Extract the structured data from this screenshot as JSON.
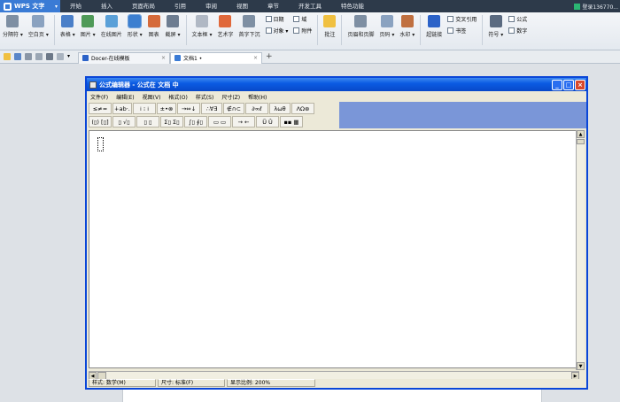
{
  "app": {
    "name": "WPS 文字",
    "login_text": "登录136770..."
  },
  "menu_tabs": [
    "开始",
    "插入",
    "页面布局",
    "引用",
    "审阅",
    "视图",
    "章节",
    "开发工具",
    "特色功能"
  ],
  "ribbon": {
    "buttons": [
      {
        "label": "分隔符 ▾"
      },
      {
        "label": "空白页 ▾"
      },
      {
        "label": "表格 ▾"
      },
      {
        "label": "图片 ▾"
      },
      {
        "label": "在线图片"
      },
      {
        "label": "形状 ▾"
      },
      {
        "label": "图表"
      },
      {
        "label": "截屏 ▾"
      },
      {
        "label": "文本框 ▾"
      },
      {
        "label": "艺术字"
      },
      {
        "label": "首字下沉"
      }
    ],
    "small_items": [
      [
        "日期",
        "对象 ▾"
      ],
      [
        "域",
        "附件"
      ]
    ],
    "buttons2": [
      {
        "label": "批注"
      },
      {
        "label": "页眉和页脚"
      },
      {
        "label": "页码 ▾"
      },
      {
        "label": "水印 ▾"
      },
      {
        "label": "超链接"
      }
    ],
    "small_items2": [
      "交叉引用",
      "书签"
    ],
    "buttons3": [
      {
        "label": "符号 ▾"
      }
    ],
    "small_items3": [
      "公式",
      "数字"
    ]
  },
  "doc_tabs": [
    {
      "label": "Docer-在线模板",
      "close": "×"
    },
    {
      "label": "文档1 •",
      "close": "×"
    }
  ],
  "equation_editor": {
    "title": "公式编辑器 - 公式在 文档 中",
    "window_buttons": {
      "minimize": "_",
      "maximize": "□",
      "close": "×"
    },
    "menu": [
      "文件(F)",
      "编辑(E)",
      "视图(V)",
      "格式(O)",
      "样式(S)",
      "尺寸(Z)",
      "帮助(H)"
    ],
    "palette_row1": [
      "≤≠≈",
      "∔ab·.",
      "⁞ ⁝ ⁞",
      "±•⊗",
      "→⇔↓",
      "∴∀∃",
      "∉∩⊂",
      "∂∞ℓ",
      "λωθ",
      "ΛΩ⊛"
    ],
    "palette_row2": [
      "(▯) [▯]",
      "▯ √▯",
      "▯ ▯",
      "Σ▯ Σ▯",
      "∫▯ ∮▯",
      "▭ ▭",
      "→ ←",
      "Ũ Û",
      "▪▪ ▦"
    ],
    "status": {
      "style": "样式: 数学(M)",
      "size": "尺寸: 标准(F)",
      "zoom": "显示比例: 200%"
    }
  },
  "colors": {
    "accent": "#3a7bd5",
    "title_blue": "#0b5be3",
    "palette_blue": "#7a96d8"
  }
}
